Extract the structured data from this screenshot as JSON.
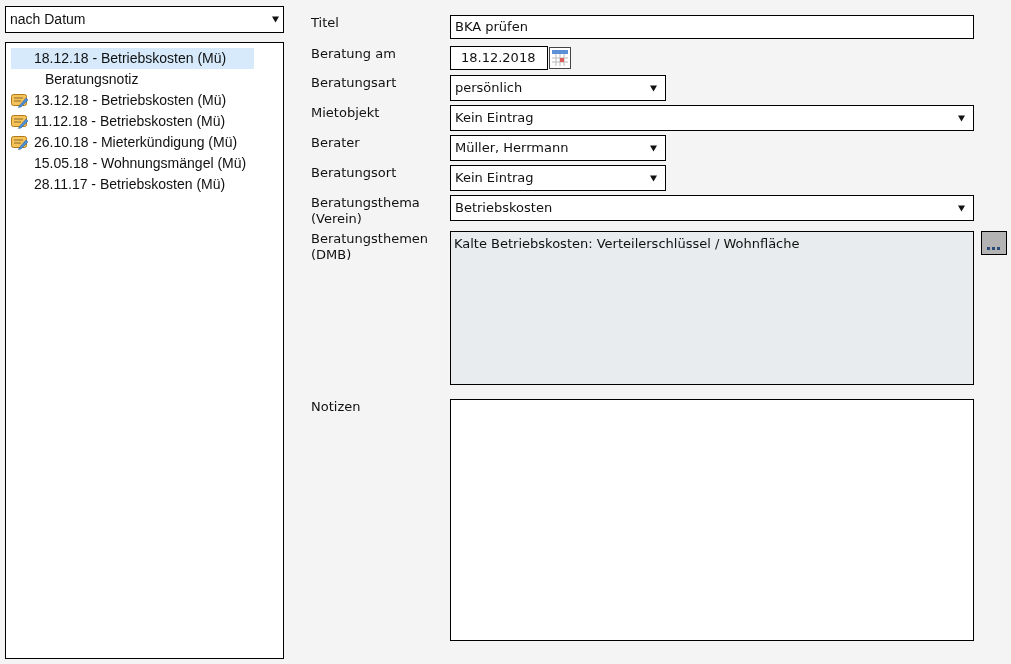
{
  "sort_select": {
    "value": "nach Datum"
  },
  "tree": [
    {
      "label": "18.12.18 - Betriebskosten (Mü)",
      "selected": true,
      "has_note": false,
      "children": [
        {
          "label": "Beratungsnotiz",
          "selected": false,
          "has_note": false
        }
      ]
    },
    {
      "label": "13.12.18 - Betriebskosten (Mü)",
      "selected": false,
      "has_note": true
    },
    {
      "label": "11.12.18 - Betriebskosten (Mü)",
      "selected": false,
      "has_note": true
    },
    {
      "label": "26.10.18 - Mieterkündigung (Mü)",
      "selected": false,
      "has_note": true
    },
    {
      "label": "15.05.18 - Wohnungsmängel (Mü)",
      "selected": false,
      "has_note": false
    },
    {
      "label": "28.11.17 - Betriebskosten (Mü)",
      "selected": false,
      "has_note": false
    }
  ],
  "form": [
    {
      "label": "Titel",
      "kind": "text",
      "value": "BKA prüfen"
    },
    {
      "label": "Beratung am",
      "kind": "date",
      "value": "18.12.2018"
    },
    {
      "label": "Beratungsart",
      "kind": "select",
      "value": "persönlich"
    },
    {
      "label": "Mietobjekt",
      "kind": "select-wide",
      "value": "Kein Eintrag"
    },
    {
      "label": "Berater",
      "kind": "select",
      "value": "Müller, Herrmann"
    },
    {
      "label": "Beratungsort",
      "kind": "select",
      "value": "Kein Eintrag"
    },
    {
      "label": "Beratungsthema (Verein)",
      "kind": "select-wide",
      "value": "Betriebskosten"
    },
    {
      "label": "Beratungsthemen (DMB)",
      "kind": "readonly-area",
      "value": "Kalte Betriebskosten: Verteilerschlüssel / Wohnfläche"
    },
    {
      "label": "Notizen",
      "kind": "textarea"
    }
  ]
}
